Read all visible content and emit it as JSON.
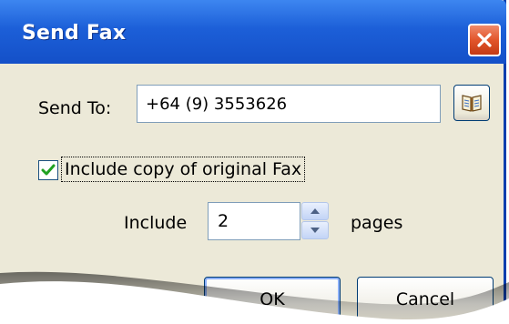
{
  "dialog": {
    "title": "Send Fax",
    "close_icon": "close-icon",
    "colors": {
      "titlebar": "#1c5fd8",
      "body": "#ece9d8",
      "close": "#e2552b"
    }
  },
  "send_to": {
    "label": "Send To:",
    "value": "+64 (9) 3553626",
    "book_icon": "address-book-icon"
  },
  "include_copy": {
    "label": "Include copy of original Fax",
    "checked": true
  },
  "pages": {
    "prefix_label": "Include",
    "value": "2",
    "suffix_label": "pages"
  },
  "buttons": {
    "ok_label": "OK",
    "cancel_label": "Cancel"
  }
}
